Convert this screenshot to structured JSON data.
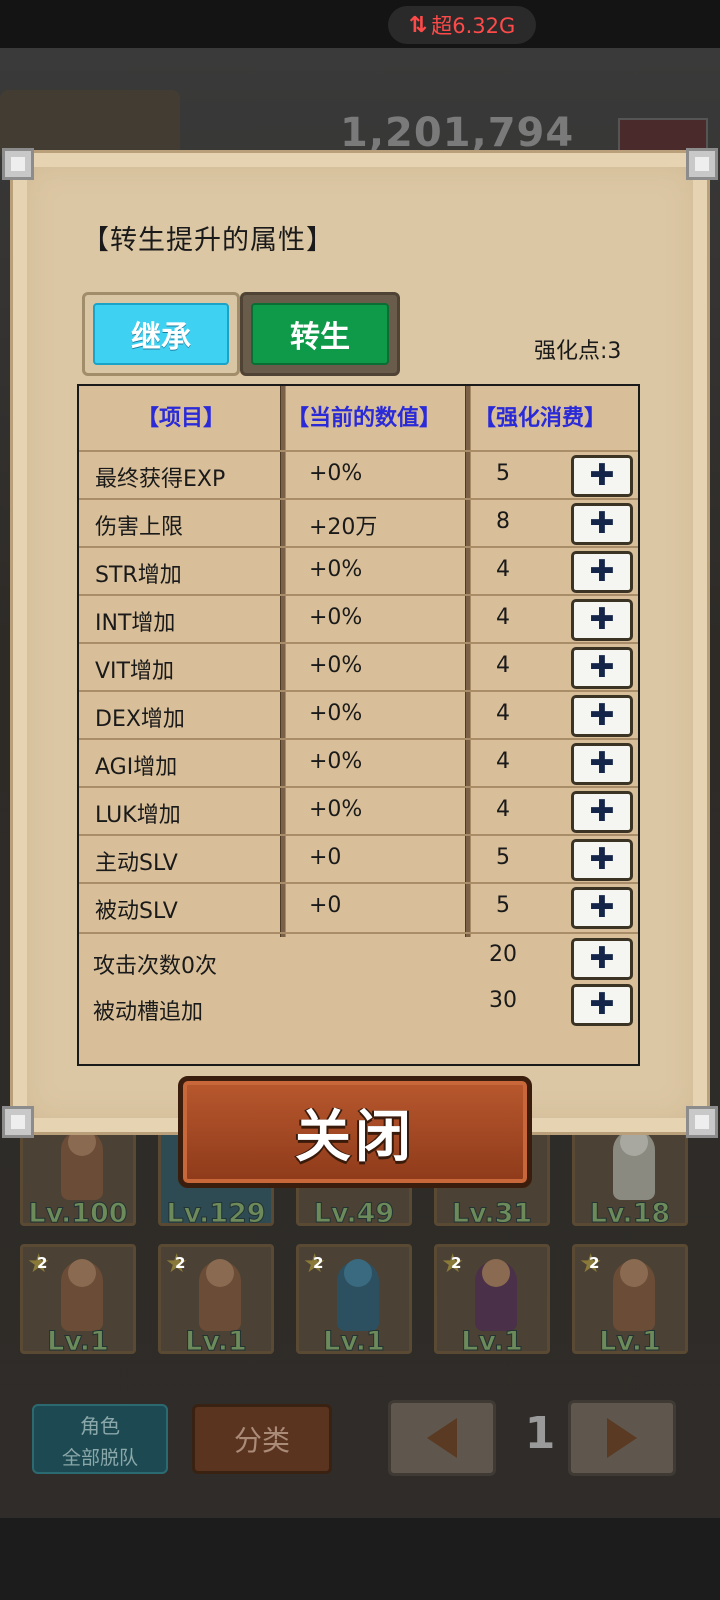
{
  "status": {
    "network": "超6.32G"
  },
  "background": {
    "gold": "1,201,794"
  },
  "dialog": {
    "title": "【转生提升的属性】",
    "tabs": [
      {
        "label": "继承"
      },
      {
        "label": "转生"
      }
    ],
    "points_label": "强化点:3",
    "headers": {
      "item": "【项目】",
      "current": "【当前的数值】",
      "cost": "【强化消费】"
    },
    "rows": [
      {
        "name": "最终获得EXP",
        "value": "+0%",
        "cost": "5"
      },
      {
        "name": "伤害上限",
        "value": "+20万",
        "cost": "8"
      },
      {
        "name": "STR增加",
        "value": "+0%",
        "cost": "4"
      },
      {
        "name": "INT增加",
        "value": "+0%",
        "cost": "4"
      },
      {
        "name": "VIT增加",
        "value": "+0%",
        "cost": "4"
      },
      {
        "name": "DEX增加",
        "value": "+0%",
        "cost": "4"
      },
      {
        "name": "AGI增加",
        "value": "+0%",
        "cost": "4"
      },
      {
        "name": "LUK增加",
        "value": "+0%",
        "cost": "4"
      },
      {
        "name": "主动SLV",
        "value": "+0",
        "cost": "5"
      },
      {
        "name": "被动SLV",
        "value": "+0",
        "cost": "5"
      }
    ],
    "extra_rows": [
      {
        "name": "攻击次数0次",
        "cost": "20"
      },
      {
        "name": "被动槽追加",
        "cost": "30"
      }
    ],
    "plus_symbol": "✚",
    "close_label": "关闭"
  },
  "cards_top": [
    {
      "level": "Lv.100"
    },
    {
      "level": "Lv.129"
    },
    {
      "level": "Lv.49"
    },
    {
      "level": "Lv.31"
    },
    {
      "level": "Lv.18"
    }
  ],
  "cards_bottom": [
    {
      "stars": "2",
      "level": "Lv.1"
    },
    {
      "stars": "2",
      "level": "Lv.1"
    },
    {
      "stars": "2",
      "level": "Lv.1"
    },
    {
      "stars": "2",
      "level": "Lv.1"
    },
    {
      "stars": "2",
      "level": "Lv.1"
    }
  ],
  "bottom_bar": {
    "role_line1": "角色",
    "role_line2": "全部脱队",
    "category": "分类",
    "page": "1"
  }
}
